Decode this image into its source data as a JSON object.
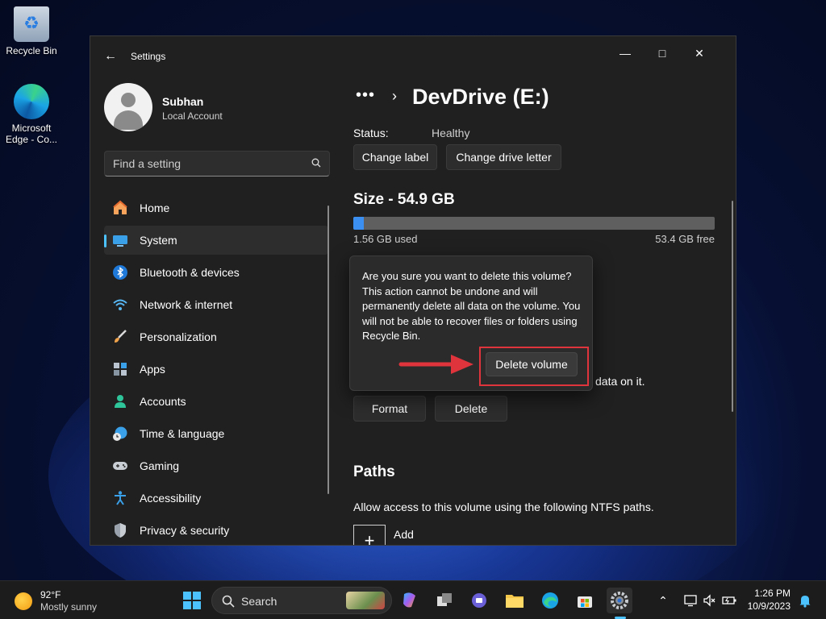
{
  "desktop": {
    "recycle_bin_label": "Recycle Bin",
    "edge_label": "Microsoft Edge - Co..."
  },
  "window": {
    "title": "Settings",
    "controls": [
      "minimize",
      "maximize",
      "close"
    ]
  },
  "profile": {
    "name": "Subhan",
    "account_type": "Local Account"
  },
  "search": {
    "placeholder": "Find a setting"
  },
  "nav": {
    "items": [
      {
        "label": "Home",
        "icon": "home-icon"
      },
      {
        "label": "System",
        "icon": "display-icon",
        "active": true
      },
      {
        "label": "Bluetooth & devices",
        "icon": "bluetooth-icon"
      },
      {
        "label": "Network & internet",
        "icon": "wifi-icon"
      },
      {
        "label": "Personalization",
        "icon": "brush-icon"
      },
      {
        "label": "Apps",
        "icon": "apps-icon"
      },
      {
        "label": "Accounts",
        "icon": "person-icon"
      },
      {
        "label": "Time & language",
        "icon": "clock-globe-icon"
      },
      {
        "label": "Gaming",
        "icon": "gamepad-icon"
      },
      {
        "label": "Accessibility",
        "icon": "accessibility-icon"
      },
      {
        "label": "Privacy & security",
        "icon": "shield-icon"
      }
    ]
  },
  "content": {
    "breadcrumb_more": "•••",
    "page_title": "DevDrive (E:)",
    "status_label": "Status:",
    "status_value": "Healthy",
    "change_label_button": "Change label",
    "change_letter_button": "Change drive letter",
    "size_title": "Size - 54.9 GB",
    "used_text": "1.56 GB used",
    "free_text": "53.4 GB free",
    "used_fraction": 0.028,
    "flyout_message": "Are you sure you want to delete this volume? This action cannot be undone and will permanently delete all data on the volume. You will not be able to recover files or folders using Recycle Bin.",
    "delete_volume_button": "Delete volume",
    "trailing_text": "data on it.",
    "format_button": "Format",
    "delete_button": "Delete",
    "paths_title": "Paths",
    "paths_description": "Allow access to this volume using the following NTFS paths.",
    "add_label": "Add"
  },
  "taskbar": {
    "weather_temp": "92°F",
    "weather_condition": "Mostly sunny",
    "search_label": "Search",
    "time": "1:26 PM",
    "date": "10/9/2023"
  },
  "colors": {
    "accent": "#4cc2ff",
    "highlight_box": "#e0343c",
    "usage_fill": "#3b8ff0"
  }
}
